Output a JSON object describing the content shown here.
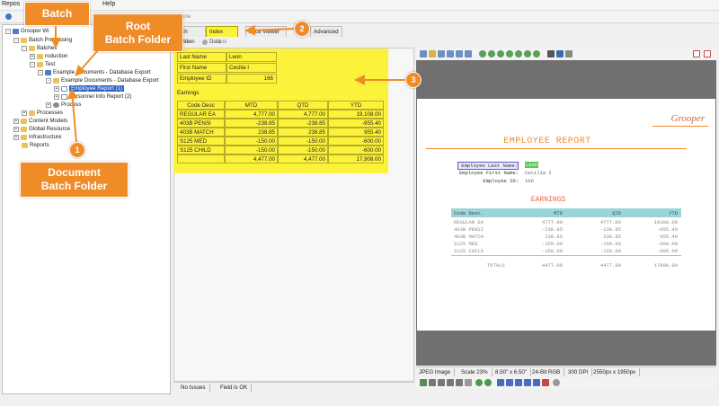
{
  "menu": {
    "items": [
      "Repos",
      "Help"
    ]
  },
  "tree": {
    "nodes": [
      "Grooper Wi",
      "Batch Processing",
      "Batches",
      "roduction",
      "Test",
      "Example Documents - Database Export",
      "Example Documents - Database Export",
      "Employee Report (1)",
      "Personnel Info Report (2)",
      "Process",
      "Processes",
      "Content Models",
      "Global Resource",
      "Infrastructure",
      "Reports"
    ]
  },
  "tabs": {
    "batch_folder": "atch Folder",
    "index_data": "Index Data",
    "viewer": "ance Viewer",
    "advanced": "Advanced",
    "none_label": "one"
  },
  "savebar": {
    "save": "Save",
    "cancel": "Cancel"
  },
  "index": {
    "fields": [
      {
        "label": "Last Name",
        "value": "Leon"
      },
      {
        "label": "First Name",
        "value": "Cecilia I"
      },
      {
        "label": "Employee ID",
        "value": "166"
      }
    ],
    "earnings_label": "Earnings",
    "columns": [
      "Code Desc",
      "MTD",
      "QTD",
      "YTD"
    ],
    "rows": [
      [
        "REGULAR EA",
        "4,777.00",
        "4,777.00",
        "19,108.00"
      ],
      [
        "403B PENSI",
        "-238.85",
        "-238.85",
        "-955.40"
      ],
      [
        "403B MATCH",
        "238.85",
        "238.85",
        "955.40"
      ],
      [
        "S125 MED",
        "-150.00",
        "-150.00",
        "-600.00"
      ],
      [
        "S125 CHILD",
        "-150.00",
        "-150.00",
        "-600.00"
      ]
    ],
    "totals": [
      "",
      "4,477.00",
      "4,477.00",
      "17,908.00"
    ]
  },
  "status": {
    "issues": "No Issues",
    "field": "Field is OK"
  },
  "report": {
    "logo": "Grooper",
    "title": "EMPLOYEE REPORT",
    "last_name_label": "Employee Last Name:",
    "last_name": "Leon",
    "first_name_label": "Employee First Name:",
    "first_name": "Cecilia I",
    "id_label": "Employee ID:",
    "id": "166",
    "earnings_title": "EARNINGS",
    "columns": [
      "Code Desc.",
      "MTD",
      "QTD",
      "YTD"
    ],
    "rows": [
      [
        "REGULAR EA",
        "4777.00",
        "4777.00",
        "19108.00"
      ],
      [
        "403B PENSI",
        "-238.85",
        "-238.85",
        "-955.40"
      ],
      [
        "403B MATCH",
        "238.85",
        "238.85",
        "955.40"
      ],
      [
        "S125 MED",
        "-150.00",
        "-150.00",
        "-600.00"
      ],
      [
        "S125 CHILD",
        "-150.00",
        "-150.00",
        "-600.00"
      ]
    ],
    "totals_label": "TOTALS",
    "totals": [
      "4477.00",
      "4477.00",
      "17908.00"
    ]
  },
  "image_status": {
    "type": "JPEG Image",
    "scale": "Scale 23%",
    "size": "8.50\" x 6.50\"",
    "depth": "24-Bit RGB",
    "dpi": "300 DPI",
    "pixels": "2550px x 1950px"
  },
  "callouts": {
    "batch": "Batch",
    "root": "Root\nBatch Folder",
    "doc": "Document\nBatch Folder",
    "n1": "1",
    "n2": "2",
    "n3": "3"
  },
  "colors": {
    "highlight": "#fdf23a",
    "callout": "#f08c28",
    "selection": "#2b63c4",
    "report_accent": "#f08c28"
  }
}
